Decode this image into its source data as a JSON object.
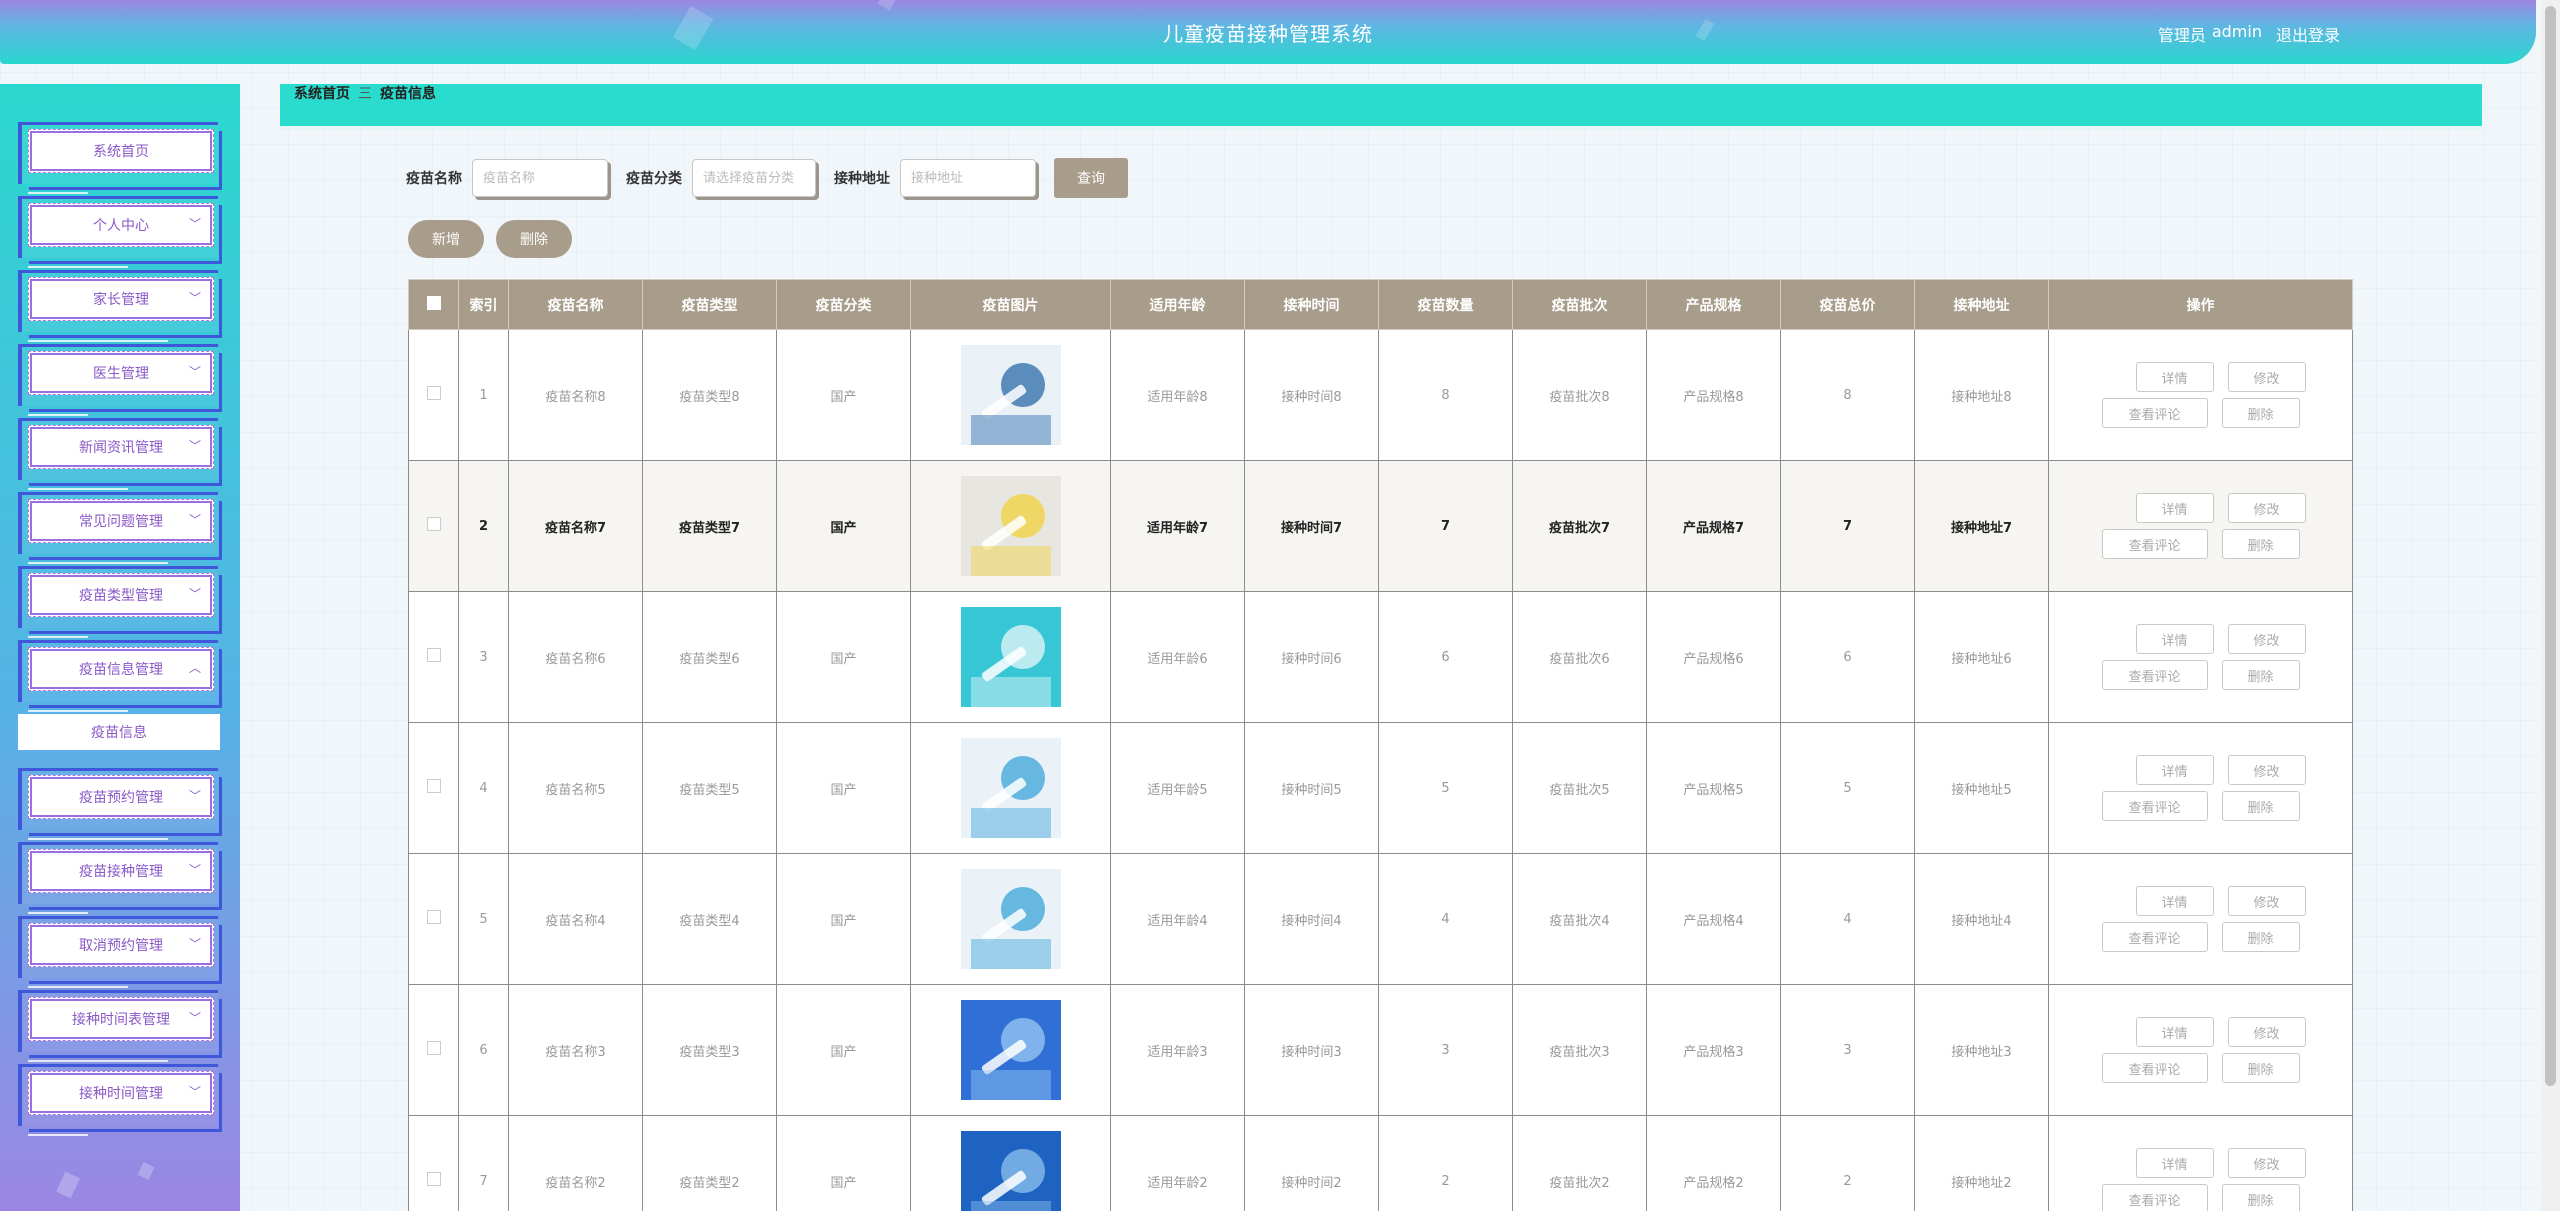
{
  "header": {
    "title": "儿童疫苗接种管理系统",
    "role": "管理员",
    "username": "admin",
    "logout": "退出登录"
  },
  "sidebar": {
    "items": [
      {
        "label": "系统首页",
        "chevron": ""
      },
      {
        "label": "个人中心",
        "chevron": "﹀"
      },
      {
        "label": "家长管理",
        "chevron": "﹀"
      },
      {
        "label": "医生管理",
        "chevron": "﹀"
      },
      {
        "label": "新闻资讯管理",
        "chevron": "﹀"
      },
      {
        "label": "常见问题管理",
        "chevron": "﹀"
      },
      {
        "label": "疫苗类型管理",
        "chevron": "﹀"
      },
      {
        "label": "疫苗信息管理",
        "chevron": "︿"
      },
      {
        "label": "疫苗预约管理",
        "chevron": "﹀"
      },
      {
        "label": "疫苗接种管理",
        "chevron": "﹀"
      },
      {
        "label": "取消预约管理",
        "chevron": "﹀"
      },
      {
        "label": "接种时间表管理",
        "chevron": "﹀"
      },
      {
        "label": "接种时间管理",
        "chevron": "﹀"
      }
    ],
    "submenu": "疫苗信息"
  },
  "breadcrumb": {
    "home": "系统首页",
    "sep": "三",
    "current": "疫苗信息"
  },
  "search": {
    "name_label": "疫苗名称",
    "name_placeholder": "疫苗名称",
    "category_label": "疫苗分类",
    "category_placeholder": "请选择疫苗分类",
    "address_label": "接种地址",
    "address_placeholder": "接种地址",
    "query": "查询"
  },
  "actions": {
    "add": "新增",
    "delete": "删除"
  },
  "table": {
    "headers": [
      "索引",
      "疫苗名称",
      "疫苗类型",
      "疫苗分类",
      "疫苗图片",
      "适用年龄",
      "接种时间",
      "疫苗数量",
      "疫苗批次",
      "产品规格",
      "疫苗总价",
      "接种地址",
      "操作"
    ],
    "ops": {
      "detail": "详情",
      "edit": "修改",
      "comments": "查看评论",
      "delete": "删除"
    },
    "rows": [
      {
        "index": "1",
        "name": "疫苗名称8",
        "type": "疫苗类型8",
        "category": "国产",
        "image": "vaccine-photo-doctor",
        "age": "适用年龄8",
        "time": "接种时间8",
        "count": "8",
        "batch": "疫苗批次8",
        "spec": "产品规格8",
        "price": "8",
        "address": "接种地址8"
      },
      {
        "index": "2",
        "name": "疫苗名称7",
        "type": "疫苗类型7",
        "category": "国产",
        "image": "vaccine-photo-syringe",
        "age": "适用年龄7",
        "time": "接种时间7",
        "count": "7",
        "batch": "疫苗批次7",
        "spec": "产品规格7",
        "price": "7",
        "address": "接种地址7"
      },
      {
        "index": "3",
        "name": "疫苗名称6",
        "type": "疫苗类型6",
        "category": "国产",
        "image": "vaccine-photo-lab",
        "age": "适用年龄6",
        "time": "接种时间6",
        "count": "6",
        "batch": "疫苗批次6",
        "spec": "产品规格6",
        "price": "6",
        "address": "接种地址6"
      },
      {
        "index": "4",
        "name": "疫苗名称5",
        "type": "疫苗类型5",
        "category": "国产",
        "image": "vaccine-photo-injection",
        "age": "适用年龄5",
        "time": "接种时间5",
        "count": "5",
        "batch": "疫苗批次5",
        "spec": "产品规格5",
        "price": "5",
        "address": "接种地址5"
      },
      {
        "index": "5",
        "name": "疫苗名称4",
        "type": "疫苗类型4",
        "category": "国产",
        "image": "vaccine-photo-injection",
        "age": "适用年龄4",
        "time": "接种时间4",
        "count": "4",
        "batch": "疫苗批次4",
        "spec": "产品规格4",
        "price": "4",
        "address": "接种地址4"
      },
      {
        "index": "6",
        "name": "疫苗名称3",
        "type": "疫苗类型3",
        "category": "国产",
        "image": "vaccine-photo-vials",
        "age": "适用年龄3",
        "time": "接种时间3",
        "count": "3",
        "batch": "疫苗批次3",
        "spec": "产品规格3",
        "price": "3",
        "address": "接种地址3"
      },
      {
        "index": "7",
        "name": "疫苗名称2",
        "type": "疫苗类型2",
        "category": "国产",
        "image": "vaccine-photo-scientist",
        "age": "适用年龄2",
        "time": "接种时间2",
        "count": "2",
        "batch": "疫苗批次2",
        "spec": "产品规格2",
        "price": "2",
        "address": "接种地址2"
      }
    ]
  },
  "colors": {
    "accent": "#29dccd",
    "button": "#a89c8b",
    "menu_border": "#3f57d9",
    "menu_text": "#8a58c7"
  }
}
